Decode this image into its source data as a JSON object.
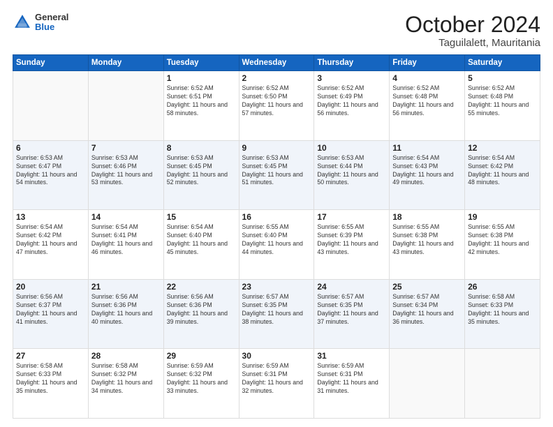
{
  "logo": {
    "general": "General",
    "blue": "Blue"
  },
  "header": {
    "month": "October 2024",
    "location": "Taguilalett, Mauritania"
  },
  "weekdays": [
    "Sunday",
    "Monday",
    "Tuesday",
    "Wednesday",
    "Thursday",
    "Friday",
    "Saturday"
  ],
  "weeks": [
    [
      {
        "day": "",
        "sunrise": "",
        "sunset": "",
        "daylight": ""
      },
      {
        "day": "",
        "sunrise": "",
        "sunset": "",
        "daylight": ""
      },
      {
        "day": "1",
        "sunrise": "Sunrise: 6:52 AM",
        "sunset": "Sunset: 6:51 PM",
        "daylight": "Daylight: 11 hours and 58 minutes."
      },
      {
        "day": "2",
        "sunrise": "Sunrise: 6:52 AM",
        "sunset": "Sunset: 6:50 PM",
        "daylight": "Daylight: 11 hours and 57 minutes."
      },
      {
        "day": "3",
        "sunrise": "Sunrise: 6:52 AM",
        "sunset": "Sunset: 6:49 PM",
        "daylight": "Daylight: 11 hours and 56 minutes."
      },
      {
        "day": "4",
        "sunrise": "Sunrise: 6:52 AM",
        "sunset": "Sunset: 6:48 PM",
        "daylight": "Daylight: 11 hours and 56 minutes."
      },
      {
        "day": "5",
        "sunrise": "Sunrise: 6:52 AM",
        "sunset": "Sunset: 6:48 PM",
        "daylight": "Daylight: 11 hours and 55 minutes."
      }
    ],
    [
      {
        "day": "6",
        "sunrise": "Sunrise: 6:53 AM",
        "sunset": "Sunset: 6:47 PM",
        "daylight": "Daylight: 11 hours and 54 minutes."
      },
      {
        "day": "7",
        "sunrise": "Sunrise: 6:53 AM",
        "sunset": "Sunset: 6:46 PM",
        "daylight": "Daylight: 11 hours and 53 minutes."
      },
      {
        "day": "8",
        "sunrise": "Sunrise: 6:53 AM",
        "sunset": "Sunset: 6:45 PM",
        "daylight": "Daylight: 11 hours and 52 minutes."
      },
      {
        "day": "9",
        "sunrise": "Sunrise: 6:53 AM",
        "sunset": "Sunset: 6:45 PM",
        "daylight": "Daylight: 11 hours and 51 minutes."
      },
      {
        "day": "10",
        "sunrise": "Sunrise: 6:53 AM",
        "sunset": "Sunset: 6:44 PM",
        "daylight": "Daylight: 11 hours and 50 minutes."
      },
      {
        "day": "11",
        "sunrise": "Sunrise: 6:54 AM",
        "sunset": "Sunset: 6:43 PM",
        "daylight": "Daylight: 11 hours and 49 minutes."
      },
      {
        "day": "12",
        "sunrise": "Sunrise: 6:54 AM",
        "sunset": "Sunset: 6:42 PM",
        "daylight": "Daylight: 11 hours and 48 minutes."
      }
    ],
    [
      {
        "day": "13",
        "sunrise": "Sunrise: 6:54 AM",
        "sunset": "Sunset: 6:42 PM",
        "daylight": "Daylight: 11 hours and 47 minutes."
      },
      {
        "day": "14",
        "sunrise": "Sunrise: 6:54 AM",
        "sunset": "Sunset: 6:41 PM",
        "daylight": "Daylight: 11 hours and 46 minutes."
      },
      {
        "day": "15",
        "sunrise": "Sunrise: 6:54 AM",
        "sunset": "Sunset: 6:40 PM",
        "daylight": "Daylight: 11 hours and 45 minutes."
      },
      {
        "day": "16",
        "sunrise": "Sunrise: 6:55 AM",
        "sunset": "Sunset: 6:40 PM",
        "daylight": "Daylight: 11 hours and 44 minutes."
      },
      {
        "day": "17",
        "sunrise": "Sunrise: 6:55 AM",
        "sunset": "Sunset: 6:39 PM",
        "daylight": "Daylight: 11 hours and 43 minutes."
      },
      {
        "day": "18",
        "sunrise": "Sunrise: 6:55 AM",
        "sunset": "Sunset: 6:38 PM",
        "daylight": "Daylight: 11 hours and 43 minutes."
      },
      {
        "day": "19",
        "sunrise": "Sunrise: 6:55 AM",
        "sunset": "Sunset: 6:38 PM",
        "daylight": "Daylight: 11 hours and 42 minutes."
      }
    ],
    [
      {
        "day": "20",
        "sunrise": "Sunrise: 6:56 AM",
        "sunset": "Sunset: 6:37 PM",
        "daylight": "Daylight: 11 hours and 41 minutes."
      },
      {
        "day": "21",
        "sunrise": "Sunrise: 6:56 AM",
        "sunset": "Sunset: 6:36 PM",
        "daylight": "Daylight: 11 hours and 40 minutes."
      },
      {
        "day": "22",
        "sunrise": "Sunrise: 6:56 AM",
        "sunset": "Sunset: 6:36 PM",
        "daylight": "Daylight: 11 hours and 39 minutes."
      },
      {
        "day": "23",
        "sunrise": "Sunrise: 6:57 AM",
        "sunset": "Sunset: 6:35 PM",
        "daylight": "Daylight: 11 hours and 38 minutes."
      },
      {
        "day": "24",
        "sunrise": "Sunrise: 6:57 AM",
        "sunset": "Sunset: 6:35 PM",
        "daylight": "Daylight: 11 hours and 37 minutes."
      },
      {
        "day": "25",
        "sunrise": "Sunrise: 6:57 AM",
        "sunset": "Sunset: 6:34 PM",
        "daylight": "Daylight: 11 hours and 36 minutes."
      },
      {
        "day": "26",
        "sunrise": "Sunrise: 6:58 AM",
        "sunset": "Sunset: 6:33 PM",
        "daylight": "Daylight: 11 hours and 35 minutes."
      }
    ],
    [
      {
        "day": "27",
        "sunrise": "Sunrise: 6:58 AM",
        "sunset": "Sunset: 6:33 PM",
        "daylight": "Daylight: 11 hours and 35 minutes."
      },
      {
        "day": "28",
        "sunrise": "Sunrise: 6:58 AM",
        "sunset": "Sunset: 6:32 PM",
        "daylight": "Daylight: 11 hours and 34 minutes."
      },
      {
        "day": "29",
        "sunrise": "Sunrise: 6:59 AM",
        "sunset": "Sunset: 6:32 PM",
        "daylight": "Daylight: 11 hours and 33 minutes."
      },
      {
        "day": "30",
        "sunrise": "Sunrise: 6:59 AM",
        "sunset": "Sunset: 6:31 PM",
        "daylight": "Daylight: 11 hours and 32 minutes."
      },
      {
        "day": "31",
        "sunrise": "Sunrise: 6:59 AM",
        "sunset": "Sunset: 6:31 PM",
        "daylight": "Daylight: 11 hours and 31 minutes."
      },
      {
        "day": "",
        "sunrise": "",
        "sunset": "",
        "daylight": ""
      },
      {
        "day": "",
        "sunrise": "",
        "sunset": "",
        "daylight": ""
      }
    ]
  ]
}
